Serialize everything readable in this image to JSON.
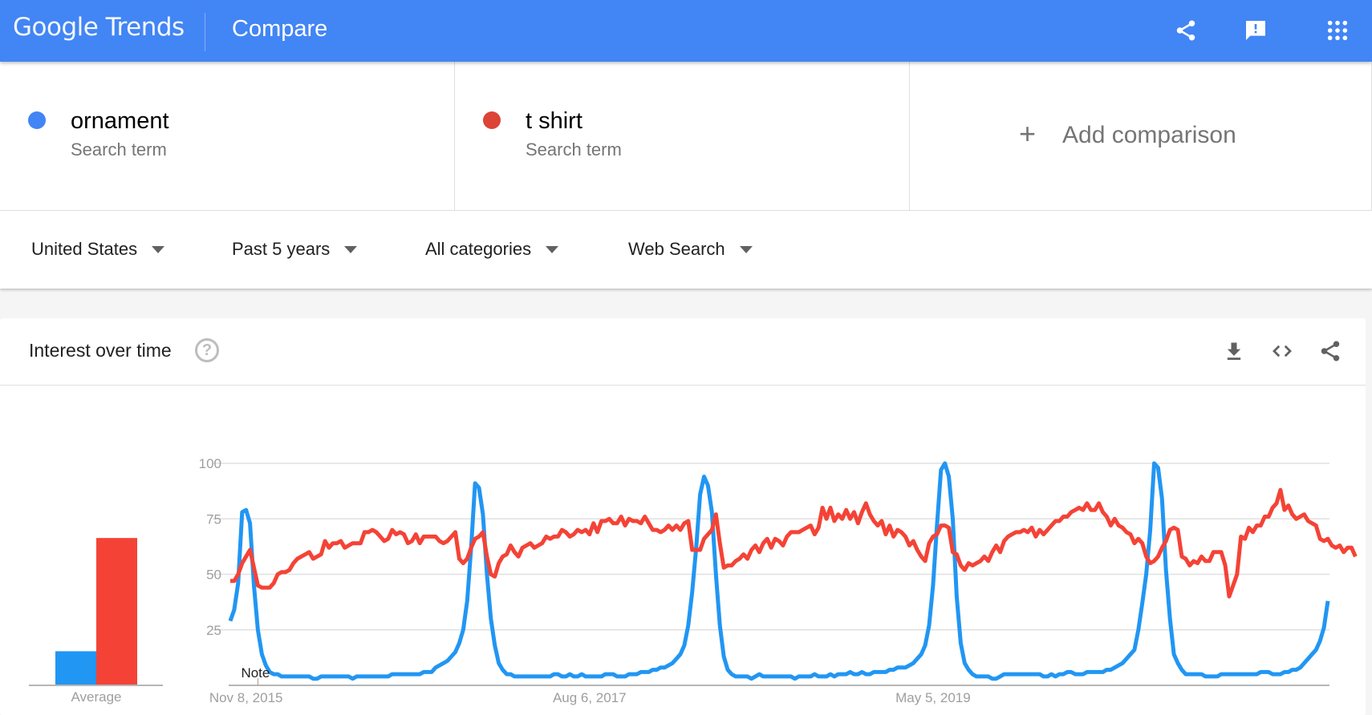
{
  "header": {
    "logo_text": "Google Trends",
    "page_title": "Compare",
    "icons": [
      "share-icon",
      "feedback-icon",
      "apps-icon"
    ]
  },
  "terms": [
    {
      "name": "ornament",
      "subtitle": "Search term",
      "color": "#4285f4"
    },
    {
      "name": "t shirt",
      "subtitle": "Search term",
      "color": "#db4437"
    }
  ],
  "add_comparison": {
    "icon": "+",
    "label": "Add comparison"
  },
  "filters": {
    "region": "United States",
    "time": "Past 5 years",
    "category": "All categories",
    "property": "Web Search"
  },
  "interest_card": {
    "title": "Interest over time",
    "help_icon": "?",
    "actions": [
      "download-icon",
      "embed-icon",
      "share-icon"
    ]
  },
  "chart_data": [
    {
      "type": "bar",
      "title": "Average",
      "categories": [
        "Average"
      ],
      "series": [
        {
          "name": "ornament",
          "color": "#2196f3",
          "values": [
            15
          ]
        },
        {
          "name": "t shirt",
          "color": "#f44336",
          "values": [
            66
          ]
        }
      ],
      "xlabel": "Average",
      "ylim": [
        0,
        100
      ]
    },
    {
      "type": "line",
      "title": "Interest over time",
      "ylim": [
        0,
        100
      ],
      "yticks": [
        25,
        50,
        75,
        100
      ],
      "grid": true,
      "x_tick_labels": [
        "Nov 8, 2015",
        "Aug 6, 2017",
        "May 5, 2019"
      ],
      "x_tick_index": [
        4,
        91,
        178
      ],
      "annotation": {
        "text": "Note",
        "index": 7
      },
      "series": [
        {
          "name": "ornament",
          "color": "#2196f3",
          "values": [
            29,
            34,
            46,
            78,
            79,
            73,
            45,
            25,
            14,
            9,
            6,
            5,
            5,
            4,
            4,
            4,
            4,
            4,
            4,
            4,
            4,
            3,
            3,
            4,
            4,
            4,
            4,
            4,
            4,
            4,
            4,
            3,
            4,
            4,
            4,
            4,
            4,
            4,
            4,
            4,
            4,
            5,
            5,
            5,
            5,
            5,
            5,
            5,
            5,
            6,
            6,
            6,
            8,
            9,
            10,
            11,
            13,
            15,
            19,
            25,
            38,
            62,
            91,
            89,
            77,
            50,
            30,
            18,
            10,
            7,
            5,
            5,
            4,
            4,
            4,
            4,
            4,
            4,
            4,
            4,
            4,
            4,
            5,
            5,
            4,
            4,
            5,
            4,
            4,
            5,
            4,
            4,
            4,
            4,
            4,
            5,
            5,
            5,
            4,
            4,
            4,
            5,
            5,
            5,
            6,
            6,
            6,
            7,
            7,
            8,
            8,
            9,
            10,
            12,
            14,
            18,
            27,
            42,
            62,
            86,
            94,
            90,
            78,
            50,
            27,
            13,
            7,
            5,
            4,
            4,
            4,
            4,
            3,
            4,
            5,
            4,
            4,
            4,
            4,
            4,
            4,
            4,
            4,
            3,
            4,
            4,
            4,
            4,
            5,
            4,
            4,
            4,
            5,
            4,
            5,
            5,
            5,
            6,
            5,
            5,
            6,
            5,
            5,
            6,
            6,
            6,
            6,
            7,
            7,
            8,
            8,
            8,
            9,
            10,
            12,
            14,
            18,
            27,
            45,
            72,
            97,
            100,
            94,
            75,
            40,
            19,
            10,
            7,
            5,
            4,
            4,
            4,
            4,
            3,
            3,
            4,
            5,
            5,
            5,
            5,
            5,
            5,
            5,
            5,
            5,
            5,
            4,
            4,
            5,
            4,
            5,
            5,
            6,
            6,
            5,
            5,
            5,
            6,
            6,
            6,
            6,
            6,
            7,
            7,
            8,
            9,
            10,
            12,
            14,
            16,
            25,
            37,
            50,
            70,
            100,
            98,
            84,
            52,
            30,
            14,
            10,
            7,
            5,
            5,
            5,
            5,
            5,
            4,
            4,
            4,
            4,
            5,
            5,
            5,
            5,
            5,
            5,
            5,
            5,
            5,
            5,
            6,
            6,
            6,
            5,
            5,
            5,
            6,
            6,
            7,
            7,
            8,
            10,
            12,
            14,
            16,
            20,
            26,
            38
          ]
        },
        {
          "name": "t shirt",
          "color": "#f44336",
          "values": [
            47,
            47,
            50,
            55,
            58,
            61,
            53,
            45,
            44,
            44,
            44,
            46,
            50,
            51,
            51,
            52,
            55,
            57,
            58,
            59,
            60,
            57,
            58,
            59,
            65,
            62,
            64,
            64,
            65,
            62,
            63,
            64,
            64,
            64,
            69,
            69,
            70,
            69,
            67,
            65,
            66,
            70,
            68,
            69,
            68,
            64,
            65,
            68,
            64,
            67,
            67,
            67,
            67,
            65,
            64,
            65,
            67,
            69,
            57,
            55,
            57,
            62,
            66,
            67,
            69,
            58,
            50,
            49,
            55,
            58,
            59,
            63,
            60,
            58,
            62,
            63,
            64,
            62,
            63,
            64,
            67,
            66,
            67,
            67,
            70,
            69,
            67,
            68,
            70,
            69,
            70,
            68,
            73,
            69,
            74,
            74,
            75,
            73,
            73,
            76,
            72,
            75,
            74,
            74,
            73,
            76,
            73,
            70,
            70,
            69,
            70,
            72,
            70,
            72,
            70,
            73,
            74,
            61,
            61,
            61,
            66,
            68,
            70,
            77,
            64,
            53,
            54,
            54,
            56,
            57,
            59,
            57,
            61,
            63,
            60,
            64,
            66,
            62,
            66,
            65,
            63,
            67,
            69,
            69,
            69,
            70,
            71,
            72,
            68,
            71,
            80,
            75,
            80,
            74,
            77,
            75,
            79,
            75,
            78,
            73,
            78,
            82,
            77,
            74,
            72,
            74,
            68,
            72,
            67,
            70,
            69,
            67,
            63,
            65,
            61,
            58,
            56,
            64,
            67,
            68,
            72,
            72,
            71,
            60,
            59,
            54,
            52,
            55,
            54,
            55,
            56,
            58,
            56,
            60,
            63,
            60,
            65,
            67,
            68,
            69,
            69,
            70,
            69,
            71,
            67,
            70,
            68,
            70,
            72,
            74,
            74,
            76,
            76,
            78,
            79,
            80,
            79,
            82,
            79,
            79,
            82,
            78,
            76,
            72,
            75,
            72,
            71,
            69,
            68,
            64,
            66,
            64,
            58,
            55,
            56,
            58,
            62,
            65,
            70,
            71,
            70,
            58,
            57,
            54,
            56,
            55,
            58,
            56,
            56,
            60,
            60,
            60,
            54,
            40,
            45,
            50,
            67,
            66,
            71,
            69,
            72,
            72,
            76,
            76,
            80,
            82,
            88,
            79,
            81,
            77,
            75,
            76,
            77,
            74,
            73,
            72,
            66,
            65,
            66,
            63,
            62,
            63,
            60,
            62,
            62,
            58
          ]
        }
      ]
    }
  ]
}
